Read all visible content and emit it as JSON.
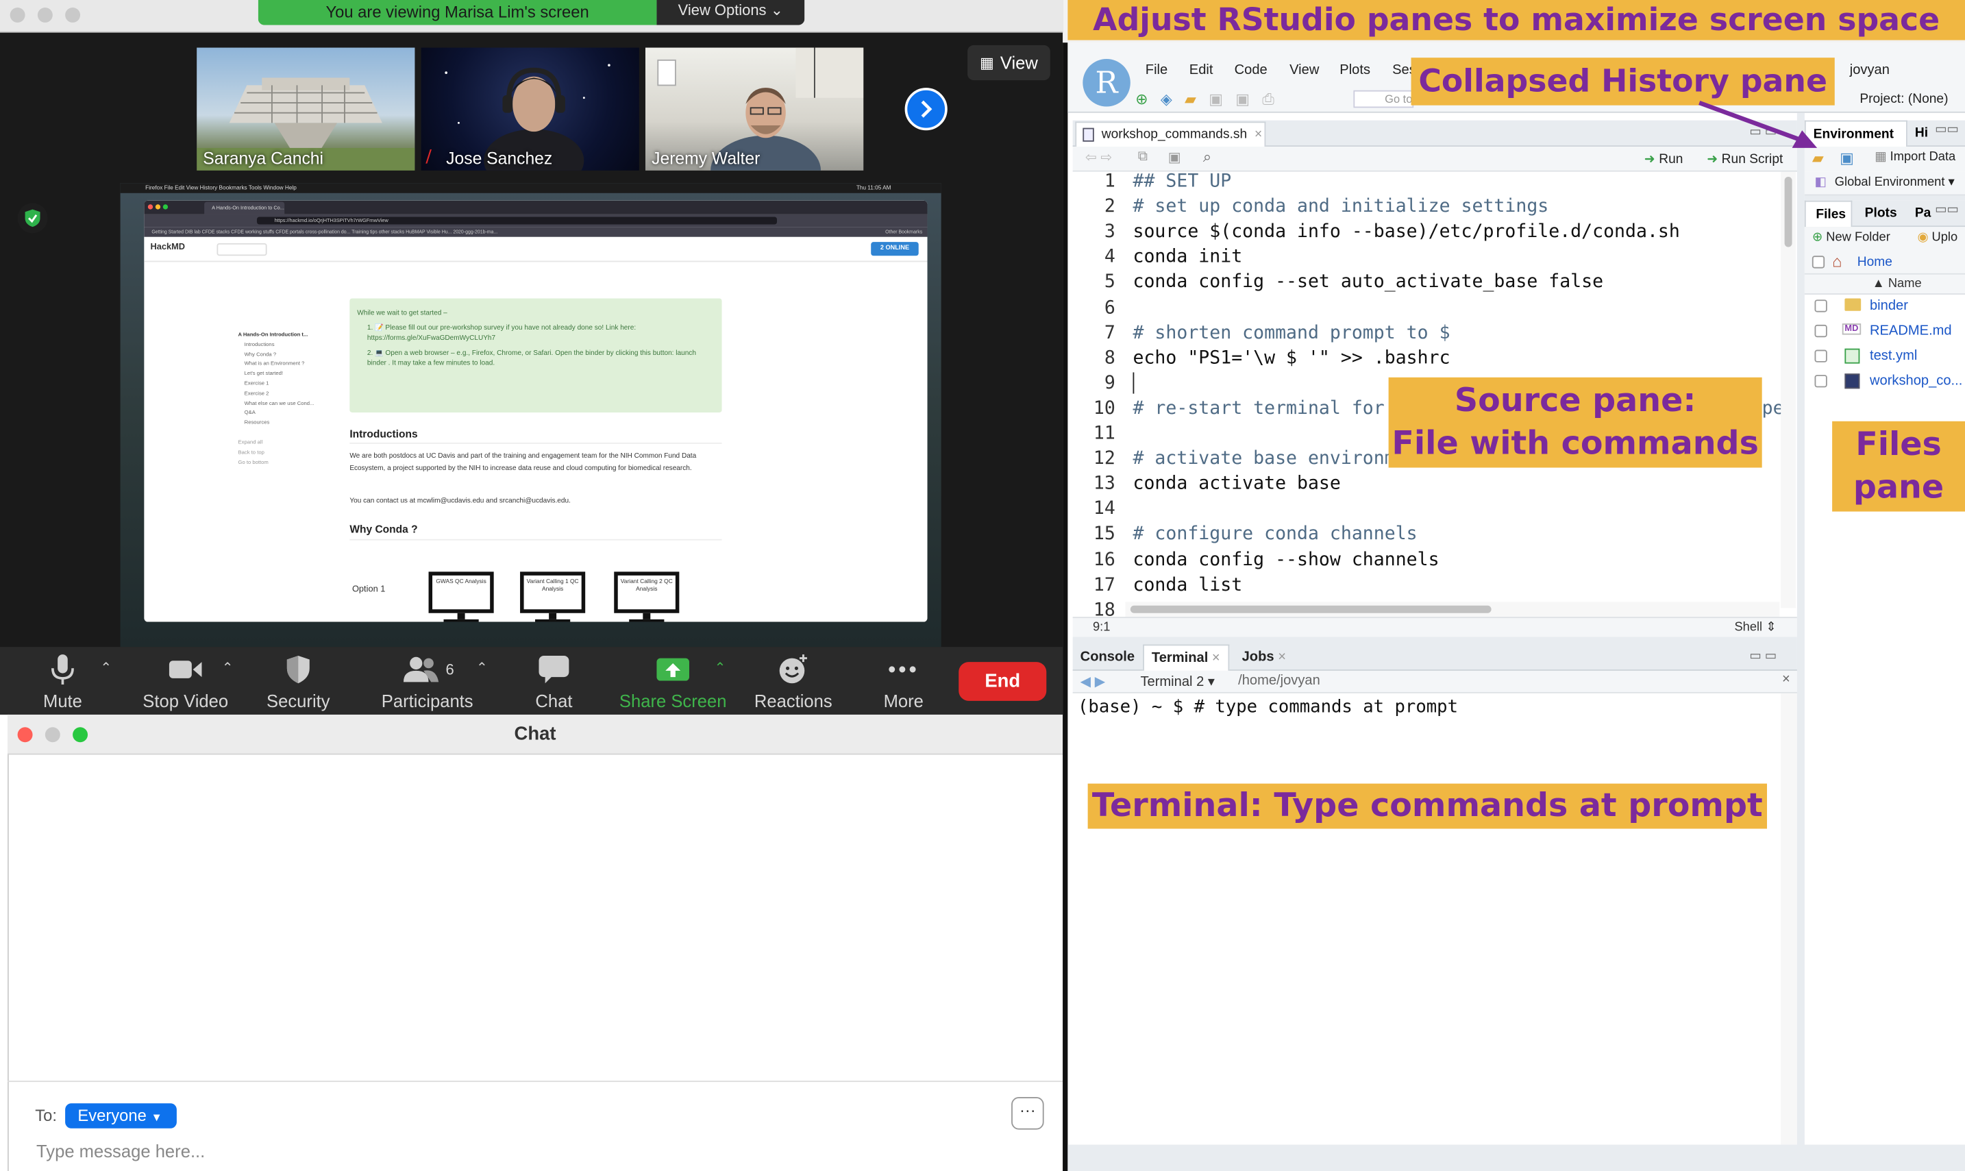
{
  "zoom": {
    "banner_text": "You are viewing Marisa Lim's screen",
    "view_options": "View Options",
    "view_button": "View",
    "participants": [
      {
        "name": "Saranya Canchi"
      },
      {
        "name": "Jose Sanchez"
      },
      {
        "name": "Jeremy Walter"
      }
    ],
    "toolbar": {
      "mute": "Mute",
      "stop_video": "Stop Video",
      "security": "Security",
      "participants": "Participants",
      "participants_count": "6",
      "chat": "Chat",
      "share_screen": "Share Screen",
      "reactions": "Reactions",
      "more": "More",
      "end": "End"
    },
    "colors": {
      "share_green": "#3fb54b",
      "end_red": "#e02828",
      "accent_blue": "#0e72ed"
    }
  },
  "shared_screen": {
    "menubar": "Firefox   File   Edit   View   History   Bookmarks   Tools   Window   Help",
    "clock": "Thu 11:05 AM",
    "tab_title": "A Hands-On Introduction to Co...",
    "url": "https://hackmd.io/oQrjHTH3SPiTVh7rWGFrnwView",
    "bookmarks": "Getting Started   DIB lab   CFDE stacks   CFDE working stuffs   CFDE portals   cross-pollination do...   Training tips   other stacks   HuBMAP Visible Hu...   2020-ggg-201b-ma...",
    "other_bookmarks": "Other Bookmarks",
    "hackmd_logo": "HackMD",
    "online_badge": "2 ONLINE",
    "toc_title": "A Hands-On Introduction t...",
    "toc_items": [
      "Introductions",
      "Why Conda ?",
      "What is an Environment ?",
      "Let's get started!",
      "Exercise 1",
      "Exercise 2",
      "What else can we use Cond...",
      "Q&A",
      "Resources"
    ],
    "toc_links": [
      "Expand all",
      "Back to top",
      "Go to bottom"
    ],
    "notice_lead": "While we wait to get started –",
    "notice_1": "1. 📝 Please fill out our pre-workshop survey if you have not already done so! Link here: https://forms.gle/XuFwaGDemWyCLUYh7",
    "notice_2": "2. 💻 Open a web browser – e.g., Firefox, Chrome, or Safari. Open the binder by clicking this button: launch binder . It may take a few minutes to load.",
    "h_intro": "Introductions",
    "p_intro": "We are both postdocs at UC Davis and part of the training and engagement team for the NIH Common Fund Data Ecosystem, a project supported by the NIH to increase data reuse and cloud computing for biomedical research.",
    "p_contact": "You can contact us at mcwlim@ucdavis.edu and srcanchi@ucdavis.edu.",
    "h_why": "Why Conda ?",
    "option_label": "Option 1",
    "monitors": [
      "GWAS QC Analysis",
      "Variant Calling 1 QC Analysis",
      "Variant Calling 2 QC Analysis"
    ]
  },
  "chat": {
    "title": "Chat",
    "to_label": "To:",
    "recipient": "Everyone",
    "placeholder": "Type message here...",
    "more": "···"
  },
  "rstudio": {
    "logo": "R",
    "menu": [
      "File",
      "Edit",
      "Code",
      "View",
      "Plots",
      "Ses"
    ],
    "user": "jovyan",
    "project": "Project: (None)",
    "goto_placeholder": "Go to",
    "source_tab": "workshop_commands.sh",
    "run": "Run",
    "run_script": "Run Script",
    "code_lines": [
      {
        "n": "1",
        "text": "## SET UP",
        "comment": true
      },
      {
        "n": "2",
        "text": "# set up conda and initialize settings",
        "comment": true
      },
      {
        "n": "3",
        "text": "source $(conda info --base)/etc/profile.d/conda.sh",
        "comment": false
      },
      {
        "n": "4",
        "text": "conda init",
        "comment": false
      },
      {
        "n": "5",
        "text": "conda config --set auto_activate_base false",
        "comment": false
      },
      {
        "n": "6",
        "text": "",
        "comment": false
      },
      {
        "n": "7",
        "text": "# shorten command prompt to $",
        "comment": true
      },
      {
        "n": "8",
        "text": "echo \"PS1='\\w $ '\" >> .bashrc",
        "comment": false
      },
      {
        "n": "9",
        "text": "",
        "comment": false
      },
      {
        "n": "10",
        "text": "# re-start terminal for t",
        "comment": true
      },
      {
        "n": "11",
        "text": "",
        "comment": false
      },
      {
        "n": "12",
        "text": "# activate base environme",
        "comment": true
      },
      {
        "n": "13",
        "text": "conda activate base",
        "comment": false
      },
      {
        "n": "14",
        "text": "",
        "comment": false
      },
      {
        "n": "15",
        "text": "# configure conda channels",
        "comment": true
      },
      {
        "n": "16",
        "text": "conda config --show channels",
        "comment": false
      },
      {
        "n": "17",
        "text": "conda list",
        "comment": false
      },
      {
        "n": "18",
        "text": "",
        "comment": false
      }
    ],
    "code_overflow_tail": "pe",
    "cursor_pos": "9:1",
    "file_type": "Shell",
    "console_tabs": [
      "Console",
      "Terminal",
      "Jobs"
    ],
    "terminal_select": "Terminal 2",
    "terminal_path": "/home/jovyan",
    "terminal_prompt": "(base) ~ $ # type commands at prompt",
    "env_tabs": [
      "Environment",
      "Hi"
    ],
    "import_data": "Import Data",
    "global_env": "Global Environment",
    "files_tabs": [
      "Files",
      "Plots",
      "Pa"
    ],
    "new_folder": "New Folder",
    "upload": "Uplo",
    "home": "Home",
    "name_col": "Name",
    "files": [
      {
        "name": "binder",
        "icon": "folder-icon"
      },
      {
        "name": "README.md",
        "icon": "markdown-file-icon"
      },
      {
        "name": "test.yml",
        "icon": "yml-file-icon"
      },
      {
        "name": "workshop_co...",
        "icon": "shell-file-icon"
      }
    ]
  },
  "annotations": {
    "title": "Adjust RStudio panes to maximize screen space",
    "history": "Collapsed History pane",
    "source_1": "Source pane:",
    "source_2": "File with commands",
    "files_1": "Files",
    "files_2": "pane",
    "terminal": "Terminal: Type commands at prompt",
    "colors": {
      "callout_bg": "#f0b742",
      "callout_text": "#7b2a9c"
    }
  }
}
